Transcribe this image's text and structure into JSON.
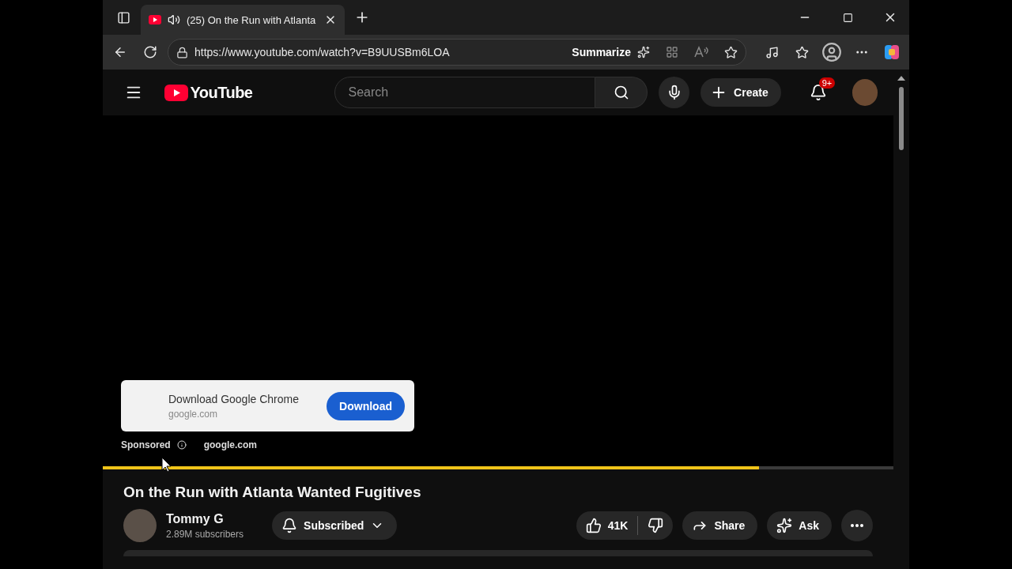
{
  "browser": {
    "tab": {
      "title": "(25) On the Run with Atlanta",
      "selected": true
    },
    "url": "https://www.youtube.com/watch?v=B9UUSBm6LOA",
    "summarize": "Summarize"
  },
  "header": {
    "logo": "YouTube",
    "search_placeholder": "Search",
    "create": "Create",
    "notifications": "9+"
  },
  "ad": {
    "title": "Download Google Chrome",
    "domain": "google.com",
    "button": "Download",
    "sponsored": "Sponsored",
    "link": "google.com"
  },
  "progress": {
    "level": 0.83
  },
  "video": {
    "title": "On the Run with Atlanta Wanted Fugitives",
    "channel": "Tommy G",
    "subscribers": "2.89M subscribers",
    "subscribe": "Subscribed",
    "likes": "41K",
    "share": "Share",
    "ask": "Ask"
  }
}
